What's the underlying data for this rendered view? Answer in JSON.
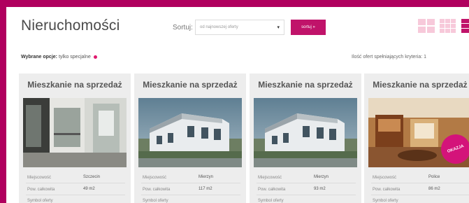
{
  "header": {
    "title": "Nieruchomości",
    "sort_label": "Sortuj:",
    "sort_value": "od najnowszej oferty",
    "sort_button": "sortuj »"
  },
  "filters": {
    "label": "Wybrane opcje:",
    "value": "tylko specjalne"
  },
  "results_text": "Ilość ofert spełniających kryteria: 1",
  "cards": [
    {
      "title": "Mieszkanie na sprzedaż",
      "attrs": [
        {
          "label": "Miejscowość",
          "value": "Szczecin"
        },
        {
          "label": "Pow. całkowita",
          "value": "49 m2"
        },
        {
          "label": "Symbol oferty",
          "value": ""
        }
      ]
    },
    {
      "title": "Mieszkanie na sprzedaż",
      "attrs": [
        {
          "label": "Miejscowość",
          "value": "Mierzyn"
        },
        {
          "label": "Pow. całkowita",
          "value": "117 m2"
        },
        {
          "label": "Symbol oferty",
          "value": ""
        }
      ]
    },
    {
      "title": "Mieszkanie na sprzedaż",
      "attrs": [
        {
          "label": "Miejscowość",
          "value": "Mierzyn"
        },
        {
          "label": "Pow. całkowita",
          "value": "93 m2"
        },
        {
          "label": "Symbol oferty",
          "value": ""
        }
      ]
    },
    {
      "title": "Mieszkanie na sprzedaż",
      "badge": "OKAZJA",
      "attrs": [
        {
          "label": "Miejscowość",
          "value": "Police"
        },
        {
          "label": "Pow. całkowita",
          "value": "86 m2"
        },
        {
          "label": "Symbol oferty",
          "value": ""
        }
      ]
    }
  ],
  "icons": {
    "grid4": "grid-large-icon",
    "grid9": "grid-small-icon",
    "list": "list-view-icon"
  },
  "colors": {
    "accent": "#c0136a",
    "frame": "#b0005e"
  }
}
